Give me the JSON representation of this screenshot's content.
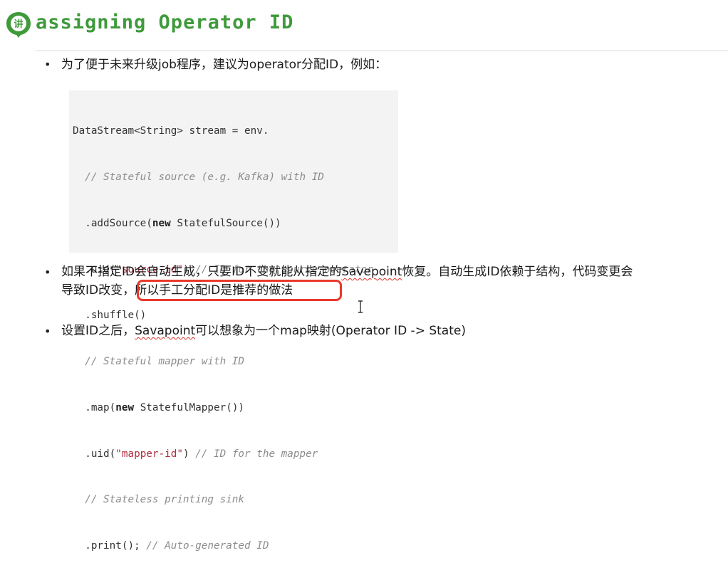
{
  "header": {
    "title": "assigning Operator ID",
    "logo_icon": "speech-bubble-logo-icon",
    "logo_glyph": "讲"
  },
  "bullets": [
    {
      "marker": "•",
      "text": "为了便于未来升级job程序，建议为operator分配ID，例如："
    },
    {
      "marker": "•",
      "line1_a": "如果不指定ID会自动生成，只要ID不变就能从指定的",
      "line1_savepoint": "Savepoint",
      "line1_b": "恢复。自动生成ID依赖于结构，代码变更会",
      "line2_a": "导致ID改变，",
      "line2_highlight": "所以手工分配ID是推荐的做法"
    },
    {
      "marker": "•",
      "text_a": "设置ID之后，",
      "text_savepoint": "Savapoint",
      "text_b": "可以想象为一个map映射(Operator ID -> State)"
    }
  ],
  "code": {
    "l1": "DataStream<String> stream = env.",
    "l2": "  // Stateful source (e.g. Kafka) with ID",
    "l3_a": "  .addSource(",
    "l3_kw": "new",
    "l3_b": " StatefulSource())",
    "l4_a": "  .uid(",
    "l4_str": "\"source-id\"",
    "l4_b": ") ",
    "l4_cm": "// ID for the source operator",
    "l5": "  .shuffle()",
    "l6": "  // Stateful mapper with ID",
    "l7_a": "  .map(",
    "l7_kw": "new",
    "l7_b": " StatefulMapper())",
    "l8_a": "  .uid(",
    "l8_str": "\"mapper-id\"",
    "l8_b": ") ",
    "l8_cm": "// ID for the mapper",
    "l9": "  // Stateless printing sink",
    "l10_a": "  .print(); ",
    "l10_cm": "// Auto-generated ID"
  },
  "colors": {
    "title": "#3f9a3b",
    "highlight_border": "#e8392a",
    "spell_underline": "#e0302a",
    "code_bg": "#f3f3f3"
  }
}
